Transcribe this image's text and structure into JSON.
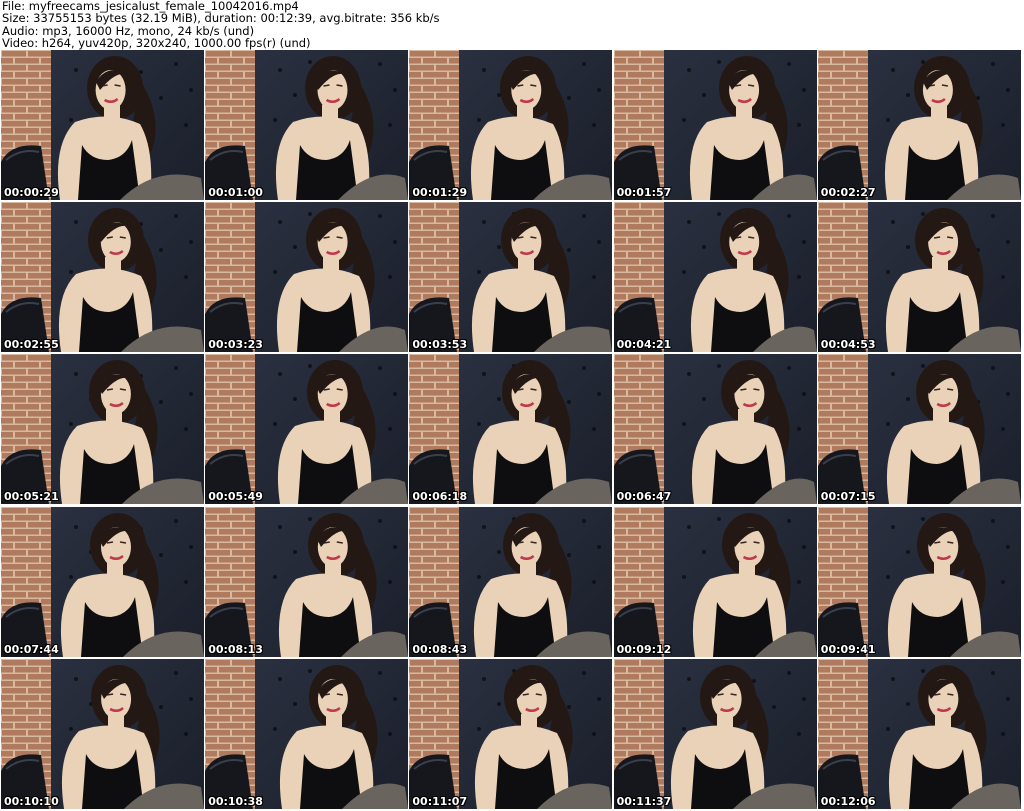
{
  "header": {
    "file_line": "File: myfreecams_jesicalust_female_10042016.mp4",
    "size_line": "Size: 33755153 bytes (32.19 MiB), duration: 00:12:39, avg.bitrate: 356 kb/s",
    "audio_line": "Audio: mp3, 16000 Hz, mono, 24 kb/s (und)",
    "video_line": "Video: h264, yuv420p, 320x240, 1000.00 fps(r) (und)"
  },
  "colors": {
    "brick": "#b07a5e",
    "brick_mortar": "#d8b9a0",
    "sofa": "#1b1f2a",
    "dress": "#0e0e10",
    "skin": "#e9d2b8",
    "hair": "#241814",
    "stockings": "#6a645e"
  },
  "thumbnails": [
    {
      "timestamp": "00:00:29"
    },
    {
      "timestamp": "00:01:00"
    },
    {
      "timestamp": "00:01:29"
    },
    {
      "timestamp": "00:01:57"
    },
    {
      "timestamp": "00:02:27"
    },
    {
      "timestamp": "00:02:55"
    },
    {
      "timestamp": "00:03:23"
    },
    {
      "timestamp": "00:03:53"
    },
    {
      "timestamp": "00:04:21"
    },
    {
      "timestamp": "00:04:53"
    },
    {
      "timestamp": "00:05:21"
    },
    {
      "timestamp": "00:05:49"
    },
    {
      "timestamp": "00:06:18"
    },
    {
      "timestamp": "00:06:47"
    },
    {
      "timestamp": "00:07:15"
    },
    {
      "timestamp": "00:07:44"
    },
    {
      "timestamp": "00:08:13"
    },
    {
      "timestamp": "00:08:43"
    },
    {
      "timestamp": "00:09:12"
    },
    {
      "timestamp": "00:09:41"
    },
    {
      "timestamp": "00:10:10"
    },
    {
      "timestamp": "00:10:38"
    },
    {
      "timestamp": "00:11:07"
    },
    {
      "timestamp": "00:11:37"
    },
    {
      "timestamp": "00:12:06"
    }
  ]
}
